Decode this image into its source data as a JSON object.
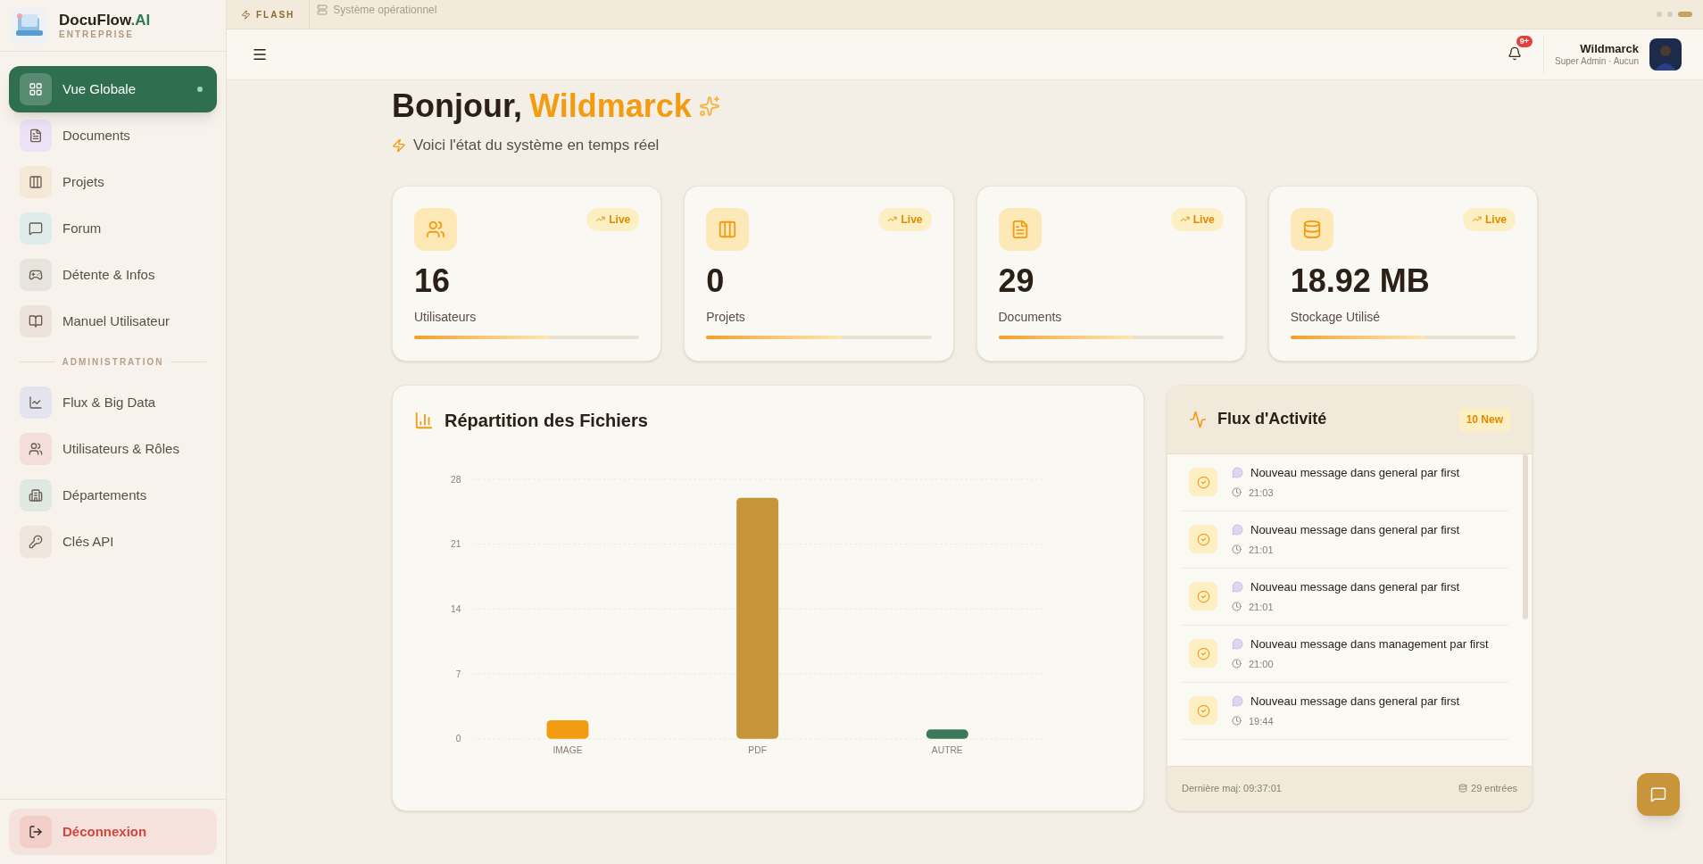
{
  "brand": {
    "name": "DocuFlow",
    "suffix": ".AI",
    "subtitle": "ENTREPRISE"
  },
  "sidebar": {
    "items": [
      {
        "label": "Vue Globale",
        "selected": true
      },
      {
        "label": "Documents",
        "selected": false,
        "color": "#ebe3f3"
      },
      {
        "label": "Projets",
        "selected": false,
        "color": "#f6e8d6"
      },
      {
        "label": "Forum",
        "selected": false,
        "color": "#e0ecec"
      },
      {
        "label": "Détente & Infos",
        "selected": false,
        "color": "#e6e4dc"
      },
      {
        "label": "Manuel Utilisateur",
        "selected": false,
        "color": "#ece2da"
      }
    ],
    "section": "ADMINISTRATION",
    "admin_items": [
      {
        "label": "Flux & Big Data",
        "selected": false,
        "color": "#e3e4ee"
      },
      {
        "label": "Utilisateurs & Rôles",
        "selected": false,
        "color": "#f3dedb"
      },
      {
        "label": "Départements",
        "selected": false,
        "color": "#dfe9e2"
      },
      {
        "label": "Clés API",
        "selected": false,
        "color": "#eee6dc"
      }
    ],
    "logout": "Déconnexion"
  },
  "top_strip": {
    "badge": "FLASH",
    "status": "Système opérationnel"
  },
  "header": {
    "notifications": "9+",
    "user": "Wildmarck",
    "role": "Super Admin · Aucun"
  },
  "greeting": {
    "prefix": "Bonjour,",
    "name": "Wildmarck",
    "subtitle": "Voici l'état du système en temps réel"
  },
  "stats": [
    {
      "value": "16",
      "label": "Utilisateurs",
      "badge": "Live",
      "level": 0.6
    },
    {
      "value": "0",
      "label": "Projets",
      "badge": "Live",
      "level": 0.6
    },
    {
      "value": "29",
      "label": "Documents",
      "badge": "Live",
      "level": 0.6
    },
    {
      "value": "18.92 MB",
      "label": "Stockage Utilisé",
      "badge": "Live",
      "level": 0.6
    }
  ],
  "chart_panel": {
    "title": "Répartition des Fichiers",
    "chart_data": {
      "type": "bar",
      "categories": [
        "IMAGE",
        "PDF",
        "AUTRE"
      ],
      "series": [
        {
          "color": "#f39c12",
          "values": [
            2,
            null,
            null
          ]
        },
        {
          "color": "#c6953a",
          "values": [
            null,
            26,
            null
          ]
        },
        {
          "color": "#3a7a5a",
          "values": [
            null,
            null,
            1
          ]
        }
      ],
      "grid": true,
      "ylim": [
        0,
        28
      ],
      "yticks": [
        0,
        7,
        14,
        21,
        28
      ]
    }
  },
  "activity": {
    "title": "Flux d'Activité",
    "badge": "10 New",
    "items": [
      {
        "text": "Nouveau message dans general par first",
        "time": "21:03"
      },
      {
        "text": "Nouveau message dans general par first",
        "time": "21:01"
      },
      {
        "text": "Nouveau message dans general par first",
        "time": "21:01"
      },
      {
        "text": "Nouveau message dans management par first",
        "time": "21:00"
      },
      {
        "text": "Nouveau message dans general par first",
        "time": "19:44"
      }
    ],
    "updated": "Dernière maj: 09:37:01",
    "count": "29 entrées"
  }
}
